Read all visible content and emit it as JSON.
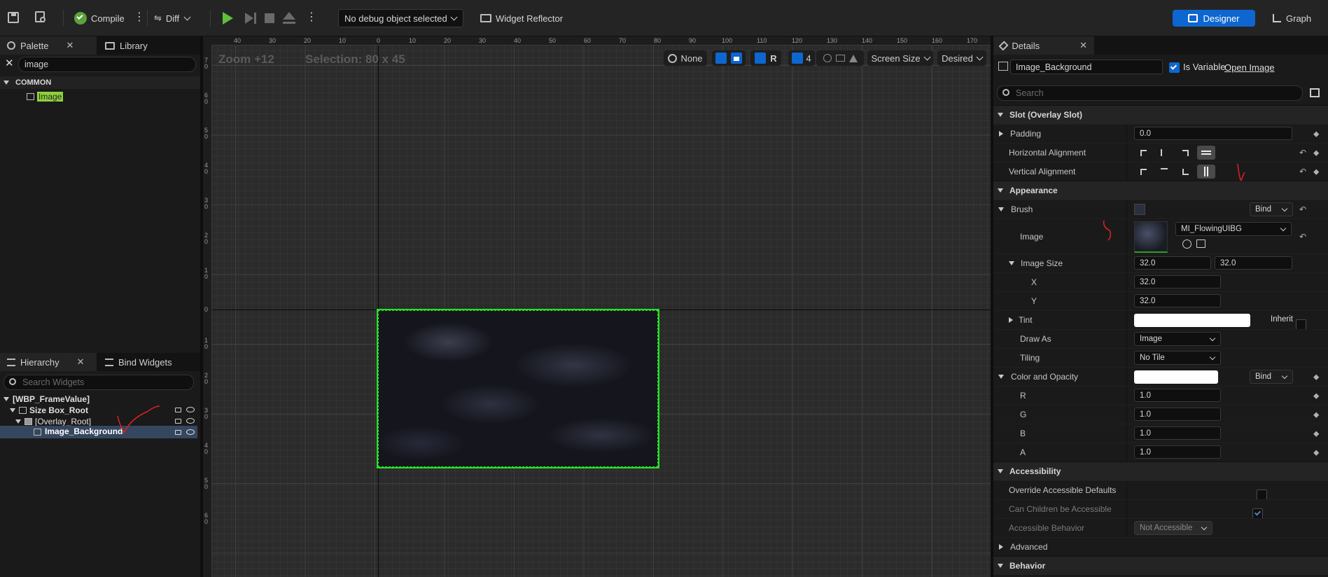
{
  "toolbar": {
    "compile_label": "Compile",
    "diff_label": "Diff",
    "debug_object": "No debug object selected",
    "widget_reflector_label": "Widget Reflector",
    "designer_label": "Designer",
    "graph_label": "Graph"
  },
  "palette": {
    "tabs": [
      {
        "label": "Palette"
      },
      {
        "label": "Library"
      }
    ],
    "search_value": "image",
    "category": "COMMON",
    "items": [
      {
        "label": "Image"
      }
    ]
  },
  "hierarchy": {
    "tabs": [
      {
        "label": "Hierarchy"
      },
      {
        "label": "Bind Widgets"
      }
    ],
    "search_placeholder": "Search Widgets",
    "nodes": [
      {
        "label": "[WBP_FrameValue]"
      },
      {
        "label": "Size Box_Root"
      },
      {
        "label": "[Overlay_Root]"
      },
      {
        "label": "Image_Background"
      }
    ]
  },
  "canvas": {
    "zoom_label": "Zoom +12",
    "selection_label": "Selection: 80 x 45",
    "none_label": "None",
    "r_label": "R",
    "grid_value": "4",
    "screen_size_label": "Screen Size",
    "desired_label": "Desired",
    "ruler_top": [
      "40",
      "30",
      "20",
      "10",
      "0",
      "10",
      "20",
      "30",
      "40",
      "50",
      "60",
      "70",
      "80",
      "90",
      "100",
      "110",
      "120",
      "130",
      "140",
      "150",
      "160",
      "170"
    ],
    "ruler_left": [
      "7 0",
      "6 0",
      "5 0",
      "4 0",
      "3 0",
      "2 0",
      "1 0",
      "0",
      "1 0",
      "2 0",
      "3 0",
      "4 0",
      "5 0",
      "6 0"
    ]
  },
  "details": {
    "tab_label": "Details",
    "widget_name": "Image_Background",
    "is_variable_label": "Is Variable",
    "open_image_label": "Open Image",
    "search_placeholder": "Search",
    "slot_section": "Slot (Overlay Slot)",
    "padding_label": "Padding",
    "padding_value": "0.0",
    "h_align_label": "Horizontal Alignment",
    "v_align_label": "Vertical Alignment",
    "appearance_section": "Appearance",
    "brush_label": "Brush",
    "bind_label": "Bind",
    "image_label": "Image",
    "image_asset": "MI_FlowingUIBG",
    "image_size_label": "Image Size",
    "image_size_x": "32.0",
    "image_size_y": "32.0",
    "x_label": "X",
    "y_label": "Y",
    "tint_label": "Tint",
    "inherit_label": "Inherit",
    "draw_as_label": "Draw As",
    "draw_as_value": "Image",
    "tiling_label": "Tiling",
    "tiling_value": "No Tile",
    "color_opacity_label": "Color and Opacity",
    "r_label": "R",
    "r_value": "1.0",
    "g_label": "G",
    "g_value": "1.0",
    "b_label": "B",
    "b_value": "1.0",
    "a_label": "A",
    "a_value": "1.0",
    "accessibility_section": "Accessibility",
    "override_label": "Override Accessible Defaults",
    "children_accessible_label": "Can Children be Accessible",
    "accessible_behavior_label": "Accessible Behavior",
    "accessible_behavior_value": "Not Accessible",
    "advanced_label": "Advanced",
    "behavior_section": "Behavior"
  },
  "colors": {
    "accent_blue": "#0e66d0",
    "selection_green": "#28e028",
    "search_highlight": "#8fd13c",
    "annotation_red": "#e02020"
  }
}
